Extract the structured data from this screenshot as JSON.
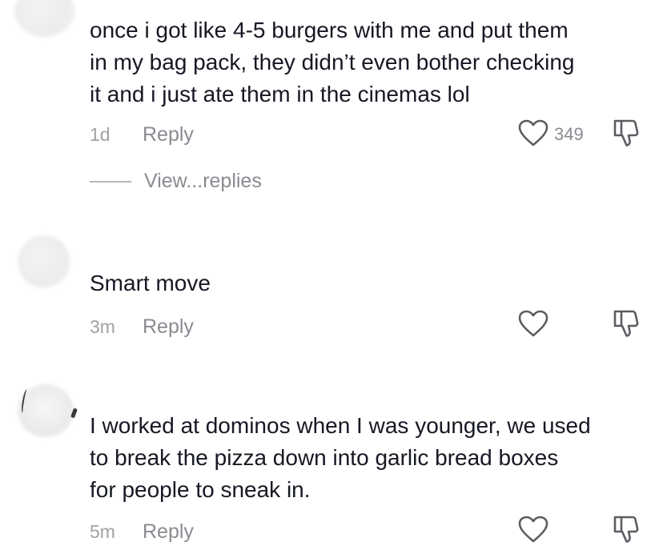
{
  "comments": [
    {
      "text": "once i got like 4-5 burgers with me and put them\nin my bag pack, they didn’t even bother checking\nit and i just ate them in the cinemas lol",
      "time": "1d",
      "reply_label": "Reply",
      "like_count": "349",
      "view_replies_label": "View...replies"
    },
    {
      "text": "Smart move",
      "time": "3m",
      "reply_label": "Reply",
      "like_count": ""
    },
    {
      "text": "I worked at dominos when I was younger, we used\nto break the pizza down into garlic bread boxes\nfor people to sneak in.",
      "time": "5m",
      "reply_label": "Reply",
      "like_count": ""
    }
  ],
  "icons": {
    "like": "heart-outline-icon",
    "dislike": "thumbs-down-outline-icon"
  },
  "colors": {
    "text": "#161823",
    "secondary": "#8a8b91",
    "timestamp": "#a1a2a7",
    "icon_stroke": "#5c5d63"
  }
}
